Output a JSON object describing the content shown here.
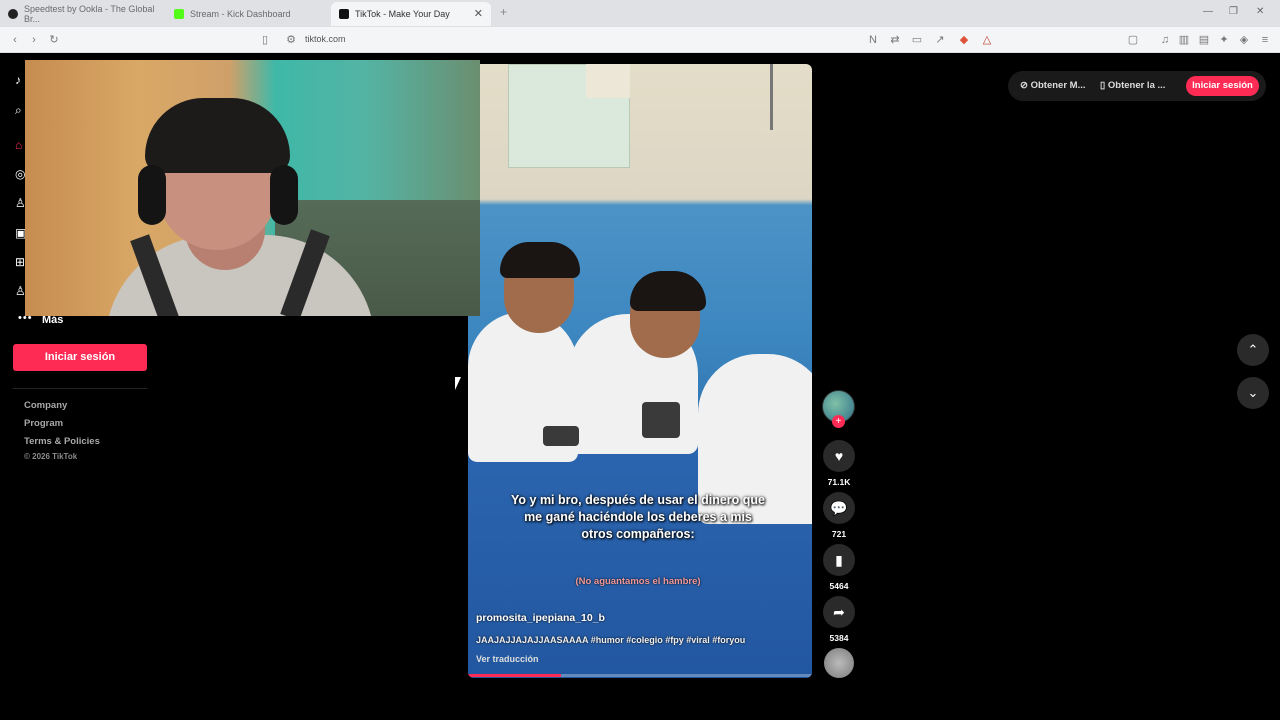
{
  "browser": {
    "tabs": [
      {
        "title": "Speedtest by Ookla - The Global Br...",
        "favicon_color": "#222222"
      },
      {
        "title": "Stream - Kick Dashboard",
        "favicon_color": "#53fc18"
      },
      {
        "title": "TikTok - Make Your Day",
        "favicon_color": "#111111"
      }
    ],
    "new_tab_symbol": "+",
    "url": "tiktok.com"
  },
  "sidebar": {
    "more_label": "Más",
    "login_label": "Iniciar sesión",
    "footer_links": [
      "Company",
      "Program",
      "Terms & Policies"
    ],
    "copyright": "© 2026 TikTok"
  },
  "video": {
    "caption": "Yo y mi bro, después de usar el dinero que me gané haciéndole los deberes a mis otros compañeros:",
    "caption_sub": "(No aguantamos el hambre)",
    "author": "promosita_ipepiana_10_b",
    "description": "JAAJAJJAJAJJAASAAAA #humor #colegio #fpy #viral #foryou",
    "translate_label": "Ver traducción",
    "progress": 0.27
  },
  "actions": {
    "likes": "71.1K",
    "comments": "721",
    "saves": "5464",
    "shares": "5384"
  },
  "topbar": {
    "get_coins": "Obtener M...",
    "get_app": "Obtener la ...",
    "login_label": "Iniciar sesión"
  },
  "colors": {
    "accent": "#fe2c55",
    "background": "#000000"
  }
}
